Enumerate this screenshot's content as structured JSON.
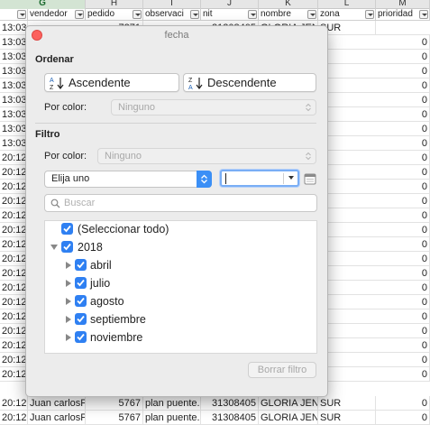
{
  "sheet": {
    "columns": [
      "G",
      "H",
      "I",
      "J",
      "K",
      "L",
      "M"
    ],
    "selected_column": "G",
    "fields": [
      "vendedor",
      "pedido",
      "observaci",
      "nit",
      "nombre",
      "zona",
      "prioridad"
    ],
    "time_column": [
      "13:03",
      "13:03",
      "13:03",
      "13:03",
      "13:03",
      "13:03",
      "13:03",
      "13:03",
      "13:03",
      "20:12",
      "20:12",
      "20:12",
      "20:12",
      "20:12",
      "20:12",
      "20:12",
      "20:12",
      "20:12",
      "20:12",
      "20:12",
      "20:12",
      "20:12",
      "20:12",
      "20:12",
      "20:12",
      "20:12",
      "20:12",
      "20:12"
    ],
    "top_partial_row": {
      "time": "13:03",
      "vendedor": "",
      "pedido": "7271",
      "observ": "",
      "nit": "21208405",
      "nombre": "GLORIA JENI",
      "zona": "SUR"
    },
    "bottom_rows": [
      {
        "time": "20:12",
        "vendedor": "Juan carlosPe",
        "pedido": "5767",
        "observ": "plan puente.",
        "nit": "31308405",
        "nombre": "GLORIA JENI",
        "zona": "SUR"
      },
      {
        "time": "20:12",
        "vendedor": "Juan carlosPe",
        "pedido": "5767",
        "observ": "plan puente.",
        "nit": "31308405",
        "nombre": "GLORIA JENI",
        "zona": "SUR"
      }
    ],
    "m_column_value": "0",
    "colors": {
      "header_bg": "#e6e6e6",
      "selected_header": "#d3e4d3"
    }
  },
  "dialog": {
    "title": "fecha",
    "sort_section": "Ordenar",
    "ascending_label": "Ascendente",
    "descending_label": "Descendente",
    "sort_color_label": "Por color:",
    "sort_color_value": "Ninguno",
    "filter_section": "Filtro",
    "filter_color_label": "Por color:",
    "filter_color_value": "Ninguno",
    "condition_value": "Elija uno",
    "search_placeholder": "Buscar",
    "select_all": "(Seleccionar todo)",
    "year": "2018",
    "months": [
      "abril",
      "julio",
      "agosto",
      "septiembre",
      "noviembre"
    ],
    "clear_button": "Borrar filtro",
    "accent_color": "#2f80f2"
  }
}
